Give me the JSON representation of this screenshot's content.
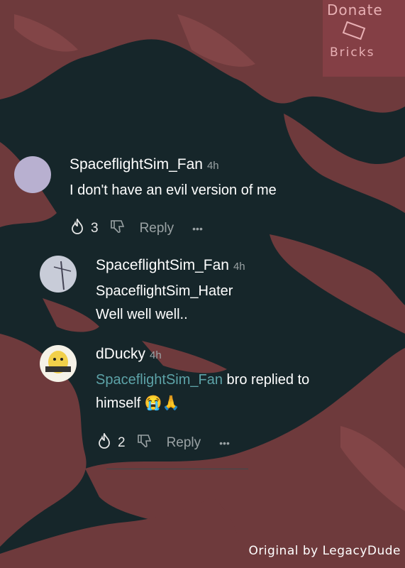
{
  "donate": {
    "title": "Donate",
    "sub": "Bricks"
  },
  "comments": [
    {
      "username": "SpaceflightSim_Fan",
      "time": "4h",
      "text": "I don't have an evil version of me",
      "likes": "3",
      "reply_label": "Reply",
      "more_label": "•••"
    },
    {
      "username": "SpaceflightSim_Fan",
      "time": "4h",
      "line1": "SpaceflightSim_Hater",
      "line2": "Well well well.."
    },
    {
      "username": "dDucky",
      "time": "4h",
      "mention": "SpaceflightSim_Fan",
      "line1_rest": " bro replied to",
      "line2": "himself",
      "emoji": "😭🙏",
      "likes": "2",
      "reply_label": "Reply",
      "more_label": "•••"
    }
  ],
  "credit": "Original by LegacyDude",
  "colors": {
    "background": "#16262a",
    "blob": "#6e3a3c",
    "mention": "#5da3a8"
  },
  "icons": [
    "fire-icon",
    "dislike-icon",
    "more-icon"
  ]
}
